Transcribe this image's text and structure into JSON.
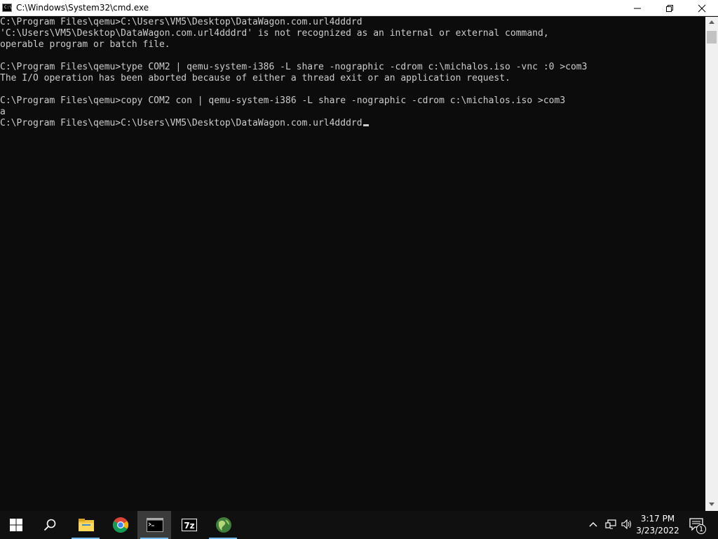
{
  "window": {
    "title": "C:\\Windows\\System32\\cmd.exe",
    "icon": "cmd-icon",
    "icon_text": "C:\\"
  },
  "console": {
    "lines": [
      "C:\\Program Files\\qemu>C:\\Users\\VM5\\Desktop\\DataWagon.com.url4dddrd",
      "'C:\\Users\\VM5\\Desktop\\DataWagon.com.url4dddrd' is not recognized as an internal or external command,",
      "operable program or batch file.",
      "",
      "C:\\Program Files\\qemu>type COM2 | qemu-system-i386 -L share -nographic -cdrom c:\\michalos.iso -vnc :0 >com3",
      "The I/O operation has been aborted because of either a thread exit or an application request.",
      "",
      "C:\\Program Files\\qemu>copy COM2 con | qemu-system-i386 -L share -nographic -cdrom c:\\michalos.iso >com3",
      "a",
      "C:\\Program Files\\qemu>C:\\Users\\VM5\\Desktop\\DataWagon.com.url4dddrd"
    ],
    "text_color": "#cccccc",
    "background": "#0c0c0c"
  },
  "taskbar": {
    "items": [
      "start-icon",
      "search-icon",
      "file-explorer-icon",
      "chrome-icon",
      "cmd-icon",
      "7zip-icon",
      "app-globe-icon"
    ],
    "active": "cmd-icon",
    "icon_7zip_text": "7z",
    "accent": "#76b9ed"
  },
  "tray": {
    "icons": [
      "chevron-up-icon",
      "network-icon",
      "volume-icon"
    ],
    "time": "3:17 PM",
    "date": "3/23/2022",
    "notification_count": "1"
  }
}
